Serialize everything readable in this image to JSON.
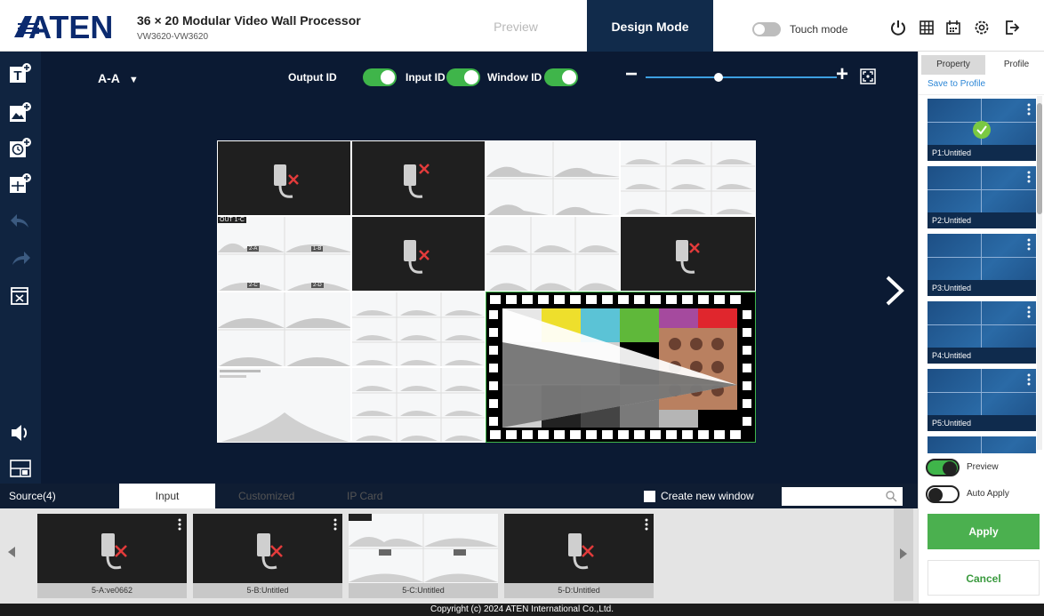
{
  "header": {
    "brand": "ATEN",
    "title": "36 × 20 Modular Video Wall Processor",
    "model": "VW3620-VW3620",
    "preview_tab": "Preview",
    "design_tab": "Design Mode",
    "touch_mode_label": "Touch mode",
    "touch_mode_on": false,
    "icons": [
      "power-icon",
      "grid-calendar-icon",
      "schedule-icon",
      "settings-icon",
      "logout-icon"
    ]
  },
  "toolbar": {
    "icons": [
      "add-text-icon",
      "add-image-icon",
      "add-clock-icon",
      "add-layout-icon",
      "undo-icon",
      "redo-icon",
      "close-window-icon",
      "volume-icon",
      "layout-grid-icon"
    ]
  },
  "canvas": {
    "layout_name": "A-A",
    "toggles": [
      {
        "label": "Output ID",
        "on": true
      },
      {
        "label": "Input ID",
        "on": true
      },
      {
        "label": "Window ID",
        "on": true
      }
    ],
    "zoom_level": 0.38,
    "cell_label": "OUT 1-C",
    "cell_sublabels": [
      "2-A",
      "1-B",
      "2-C",
      "2-D"
    ]
  },
  "source_panel": {
    "source_label": "Source(4)",
    "tabs": [
      "Input",
      "Customized",
      "IP Card"
    ],
    "active_tab": "Input",
    "create_new_window": "Create new window",
    "sources": [
      {
        "label": "5-A:ve0662",
        "type": "no-signal"
      },
      {
        "label": "5-B:Untitled",
        "type": "no-signal"
      },
      {
        "label": "5-C:Untitled",
        "type": "waveform"
      },
      {
        "label": "5-D:Untitled",
        "type": "no-signal"
      }
    ]
  },
  "right_panel": {
    "tab_property": "Property",
    "tab_profile": "Profile",
    "save_to_profile": "Save to Profile",
    "profiles": [
      "P1:Untitled",
      "P2:Untitled",
      "P3:Untitled",
      "P4:Untitled",
      "P5:Untitled"
    ],
    "selected_profile": "P1:Untitled",
    "preview_label": "Preview",
    "auto_apply_label": "Auto Apply",
    "preview_on": true,
    "auto_apply_on": false,
    "apply_label": "Apply",
    "cancel_label": "Cancel"
  },
  "footer": {
    "copyright": "Copyright (c) 2024 ATEN International Co.,Ltd."
  },
  "colors": {
    "dark_navy": "#0b1a33",
    "toolbar_navy": "#102440",
    "accent_green": "#3fb54a",
    "link_blue": "#2b86d6"
  }
}
